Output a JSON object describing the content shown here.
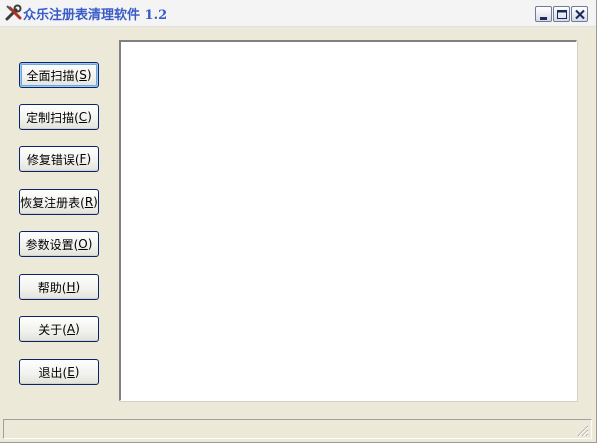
{
  "window": {
    "title": "众乐注册表清理软件 1.2",
    "icon": "tools-icon",
    "controls": [
      "minimize-icon",
      "maximize-icon",
      "close-icon"
    ]
  },
  "sidebar": {
    "buttons": [
      {
        "label": "全面扫描(",
        "accel": "S",
        "tail": ")"
      },
      {
        "label": "定制扫描(",
        "accel": "C",
        "tail": ")"
      },
      {
        "label": "修复错误(",
        "accel": "F",
        "tail": ")"
      },
      {
        "label": "恢复注册表(",
        "accel": "R",
        "tail": ")"
      },
      {
        "label": "参数设置(",
        "accel": "O",
        "tail": ")"
      },
      {
        "label": "帮助(",
        "accel": "H",
        "tail": ")"
      },
      {
        "label": "关于(",
        "accel": "A",
        "tail": ")"
      },
      {
        "label": "退出(",
        "accel": "E",
        "tail": ")"
      }
    ]
  },
  "colors": {
    "title_text": "#3a5cc8",
    "window_bg": "#ece9d8",
    "button_border": "#0a246a"
  }
}
